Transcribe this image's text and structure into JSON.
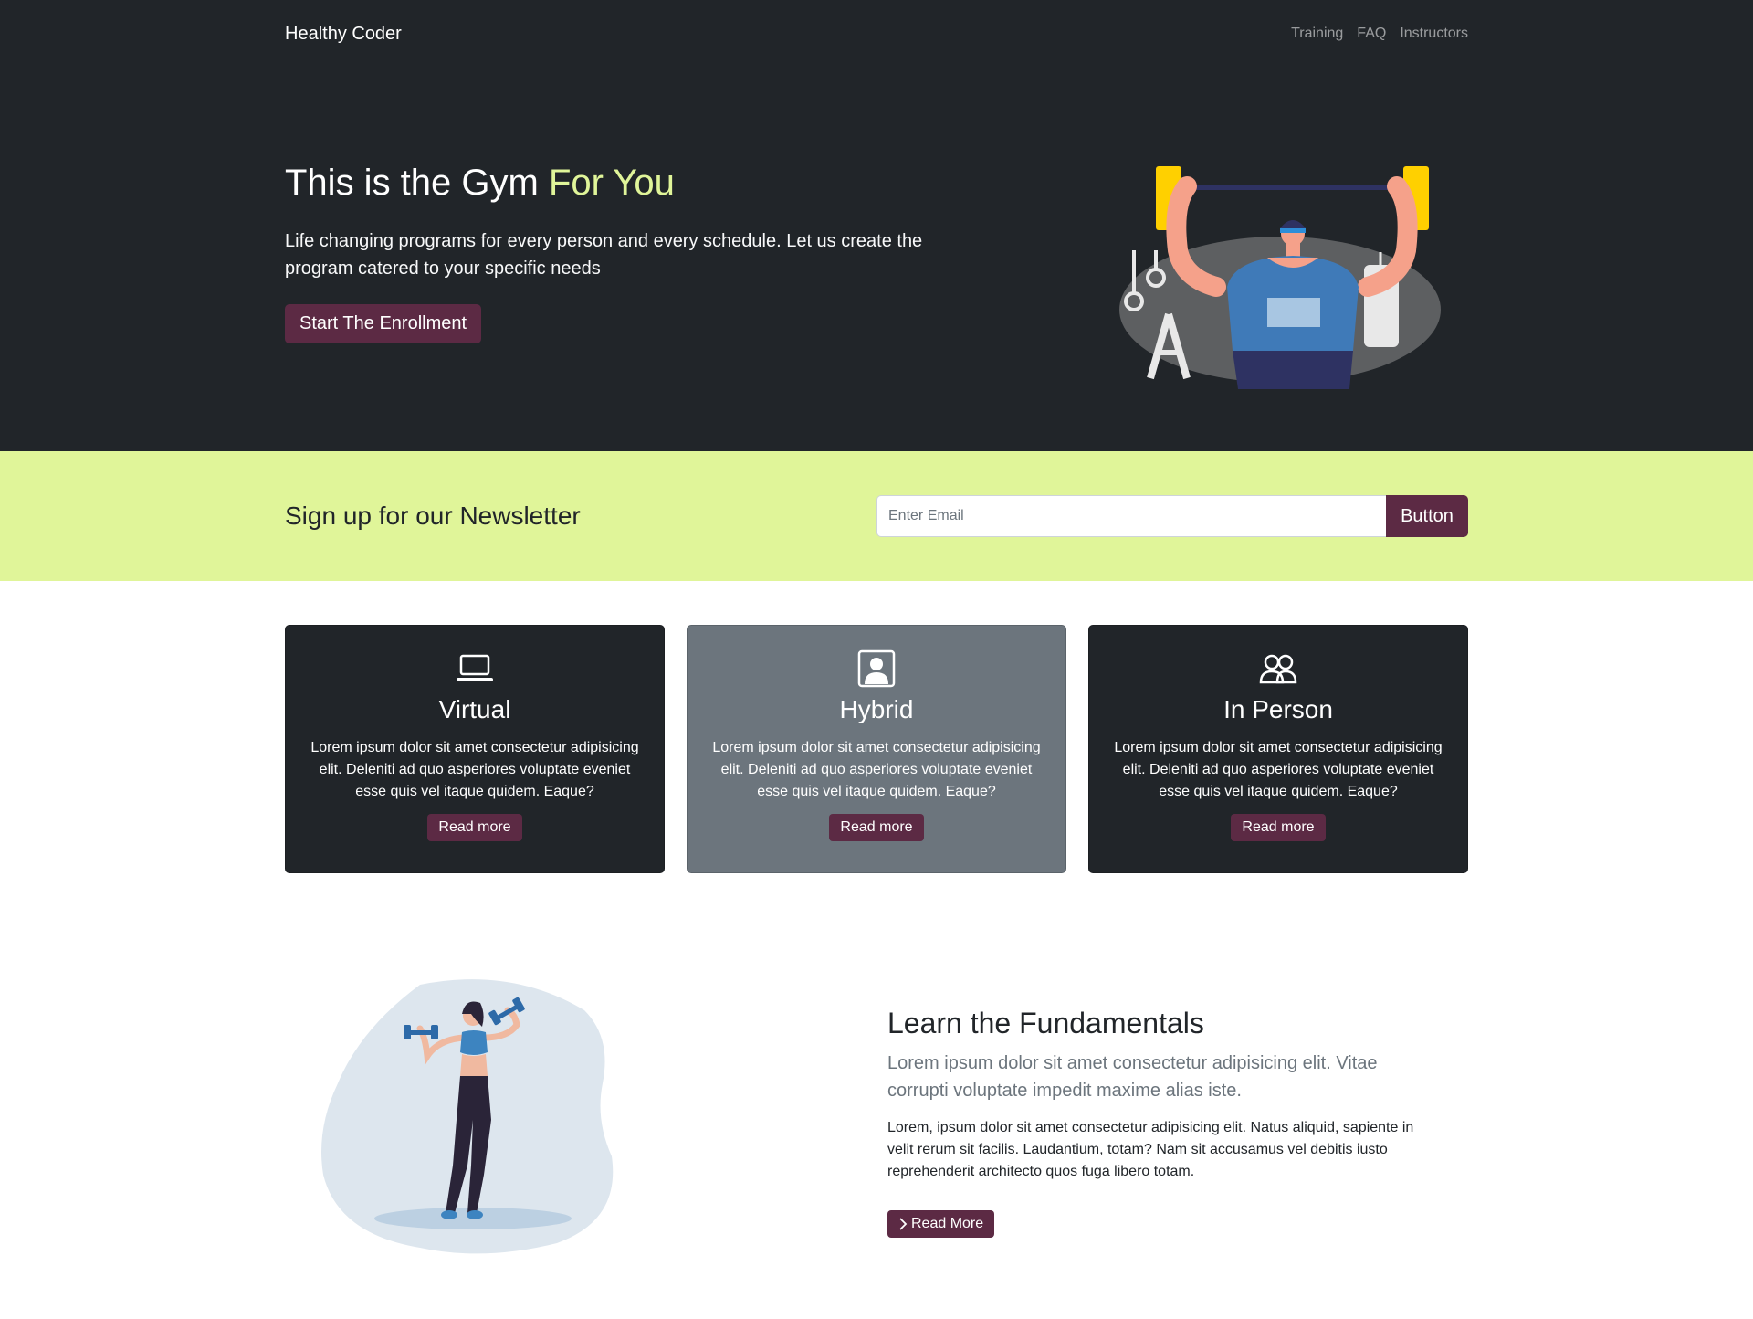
{
  "nav": {
    "brand": "Healthy Coder",
    "links": [
      "Training",
      "FAQ",
      "Instructors"
    ]
  },
  "hero": {
    "title_main": "This is the Gym ",
    "title_accent": "For You",
    "lead": "Life changing programs for every person and every schedule. Let us create the program catered to your specific needs",
    "cta": "Start The Enrollment"
  },
  "newsletter": {
    "title": "Sign up for our Newsletter",
    "email_placeholder": "Enter Email",
    "email_value": "",
    "button": "Button"
  },
  "cards": [
    {
      "icon": "laptop-icon",
      "title": "Virtual",
      "text": "Lorem ipsum dolor sit amet consectetur adipisicing elit. Deleniti ad quo asperiores voluptate eveniet esse quis vel itaque quidem. Eaque?",
      "button": "Read more"
    },
    {
      "icon": "person-square-icon",
      "title": "Hybrid",
      "text": "Lorem ipsum dolor sit amet consectetur adipisicing elit. Deleniti ad quo asperiores voluptate eveniet esse quis vel itaque quidem. Eaque?",
      "button": "Read more"
    },
    {
      "icon": "people-icon",
      "title": "In Person",
      "text": "Lorem ipsum dolor sit amet consectetur adipisicing elit. Deleniti ad quo asperiores voluptate eveniet esse quis vel itaque quidem. Eaque?",
      "button": "Read more"
    }
  ],
  "learn": {
    "title": "Learn the Fundamentals",
    "lead": "Lorem ipsum dolor sit amet consectetur adipisicing elit. Vitae corrupti voluptate impedit maxime alias iste.",
    "body": "Lorem, ipsum dolor sit amet consectetur adipisicing elit. Natus aliquid, sapiente in velit rerum sit facilis. Laudantium, totam? Nam sit accusamus vel debitis iusto reprehenderit architecto quos fuga libero totam.",
    "button": "Read More",
    "button_icon": "chevron-right-icon"
  },
  "colors": {
    "dark": "#212529",
    "accent_lime": "#e0f599",
    "button_plum": "#5c2a44",
    "card_gray": "#6c757d"
  }
}
